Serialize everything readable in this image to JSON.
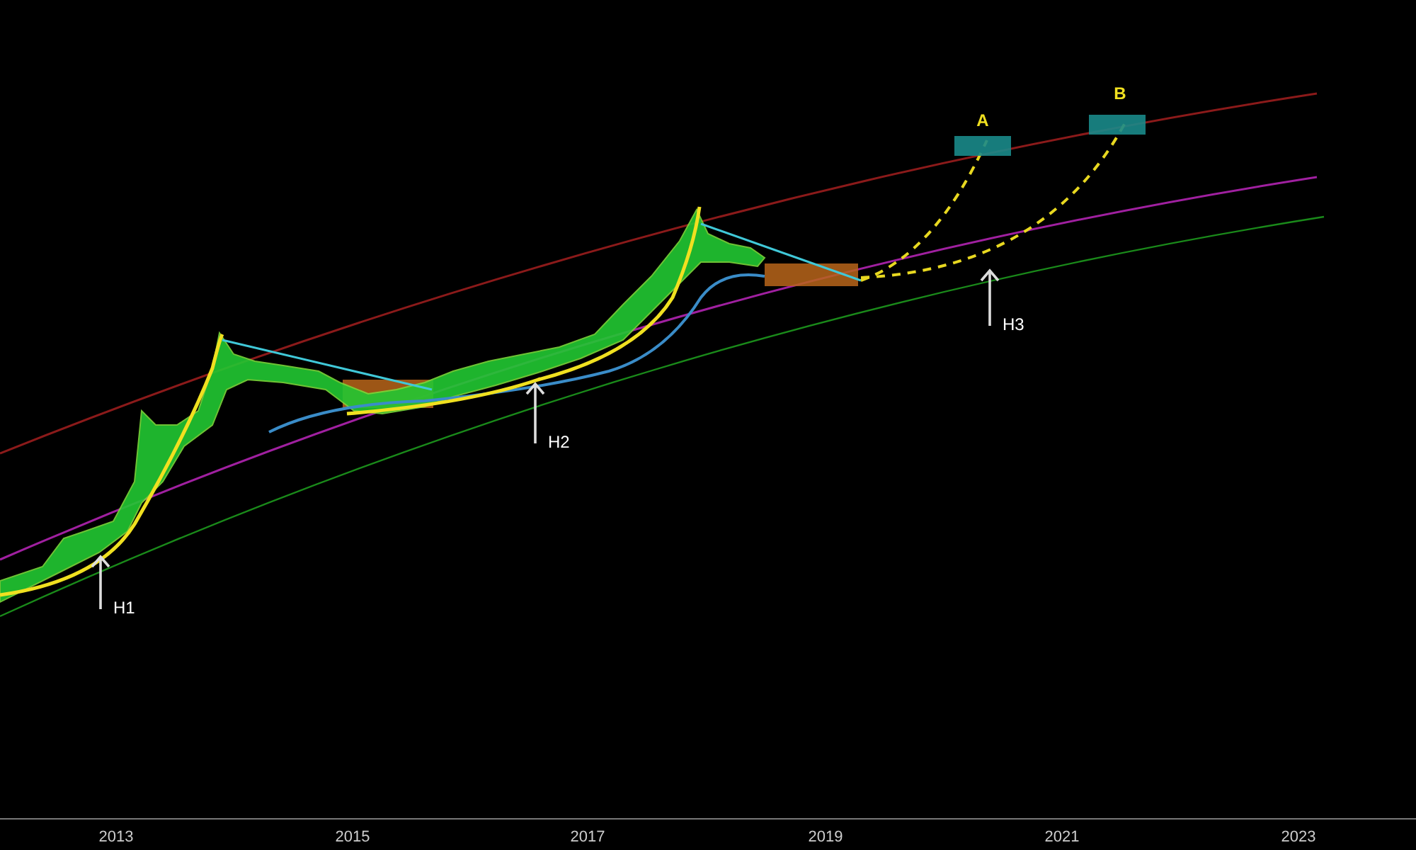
{
  "chart": {
    "x_axis_labels": [
      "2013",
      "2015",
      "2017",
      "2019",
      "2021",
      "2023"
    ],
    "annotations": [
      {
        "kind": "arrow",
        "label": "H1"
      },
      {
        "kind": "arrow",
        "label": "H2"
      },
      {
        "kind": "arrow",
        "label": "H3"
      },
      {
        "kind": "target",
        "label": "A"
      },
      {
        "kind": "target",
        "label": "B"
      }
    ]
  }
}
